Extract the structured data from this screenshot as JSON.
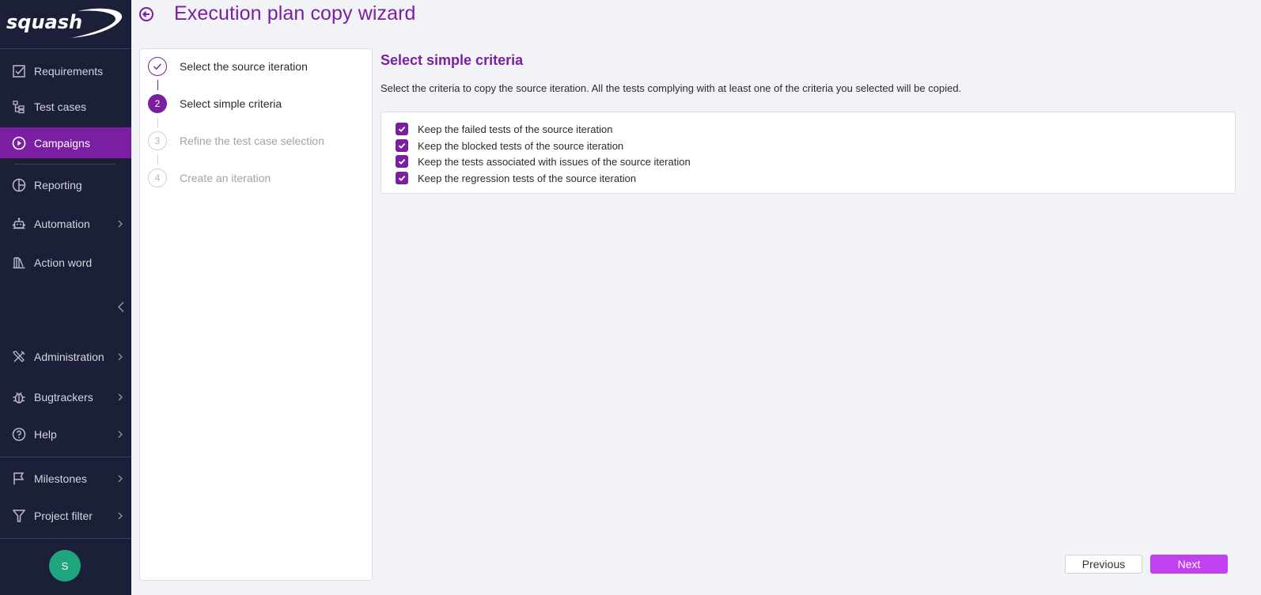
{
  "app": {
    "logo_text": "squash"
  },
  "sidebar": {
    "items": [
      {
        "label": "Requirements",
        "icon": "checkbox-icon",
        "active": false,
        "has_submenu": false
      },
      {
        "label": "Test cases",
        "icon": "tree-icon",
        "active": false,
        "has_submenu": false
      },
      {
        "label": "Campaigns",
        "icon": "play-circle-icon",
        "active": true,
        "has_submenu": false
      },
      {
        "label": "Reporting",
        "icon": "pie-chart-icon",
        "active": false,
        "has_submenu": false
      },
      {
        "label": "Automation",
        "icon": "robot-icon",
        "active": false,
        "has_submenu": true
      },
      {
        "label": "Action word",
        "icon": "library-icon",
        "active": false,
        "has_submenu": false
      },
      {
        "label": "Administration",
        "icon": "tools-icon",
        "active": false,
        "has_submenu": true
      },
      {
        "label": "Bugtrackers",
        "icon": "bug-icon",
        "active": false,
        "has_submenu": true
      },
      {
        "label": "Help",
        "icon": "help-circle-icon",
        "active": false,
        "has_submenu": true
      },
      {
        "label": "Milestones",
        "icon": "flag-icon",
        "active": false,
        "has_submenu": true
      },
      {
        "label": "Project filter",
        "icon": "filter-icon",
        "active": false,
        "has_submenu": true
      }
    ],
    "collapse_icon": "chevron-left-icon",
    "avatar_initial": "S",
    "avatar_color": "#1fa67f"
  },
  "header": {
    "back_icon": "arrow-left-circle-icon",
    "title": "Execution plan copy wizard"
  },
  "stepper": {
    "steps": [
      {
        "number": "1",
        "label": "Select the source iteration",
        "state": "done"
      },
      {
        "number": "2",
        "label": "Select simple criteria",
        "state": "current"
      },
      {
        "number": "3",
        "label": "Refine the test case selection",
        "state": "todo"
      },
      {
        "number": "4",
        "label": "Create an iteration",
        "state": "todo"
      }
    ]
  },
  "main": {
    "title": "Select simple criteria",
    "description": "Select the criteria to copy the source iteration. All the tests complying with at least one of the criteria you selected will be copied.",
    "criteria": [
      {
        "label": "Keep the failed tests of the source iteration",
        "checked": true
      },
      {
        "label": "Keep the blocked tests of the source iteration",
        "checked": true
      },
      {
        "label": "Keep the tests associated with issues of the source iteration",
        "checked": true
      },
      {
        "label": "Keep the regression tests of the source iteration",
        "checked": true
      }
    ]
  },
  "footer": {
    "previous_label": "Previous",
    "next_label": "Next"
  },
  "colors": {
    "brand_purple": "#7b1fa2",
    "next_button": "#c140f0",
    "sidebar_bg": "#1b1f38"
  }
}
